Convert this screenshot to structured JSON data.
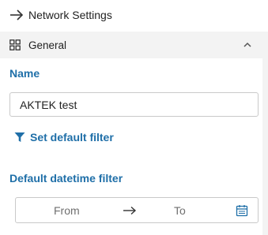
{
  "header": {
    "title": "Network Settings",
    "back_icon": "arrow-right-icon"
  },
  "section": {
    "label": "General",
    "icon": "grid-icon",
    "expanded": true,
    "chevron_icon": "chevron-up-icon"
  },
  "fields": {
    "name_label": "Name",
    "name_value": "AKTEK test",
    "filter_link_label": "Set default filter",
    "filter_icon": "funnel-icon",
    "datetime_label": "Default datetime filter",
    "from_placeholder": "From",
    "to_placeholder": "To",
    "calendar_icon": "calendar-icon"
  },
  "colors": {
    "accent": "#1f6fa8",
    "section_bg": "#f3f3f3",
    "border": "#c9c9c9",
    "placeholder": "#6f6f6f"
  }
}
